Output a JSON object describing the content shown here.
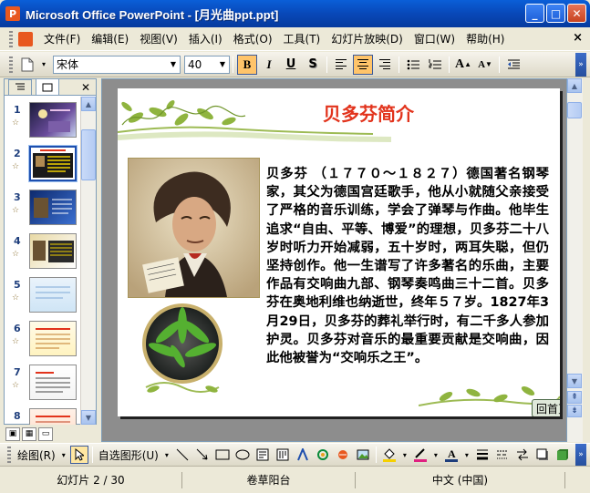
{
  "window": {
    "title": "Microsoft Office PowerPoint - [月光曲ppt.ppt]"
  },
  "menubar": {
    "items": [
      "文件(F)",
      "编辑(E)",
      "视图(V)",
      "插入(I)",
      "格式(O)",
      "工具(T)",
      "幻灯片放映(D)",
      "窗口(W)",
      "帮助(H)"
    ]
  },
  "format_toolbar": {
    "font_name": "宋体",
    "font_size": "40",
    "bold": "B",
    "italic": "I",
    "underline": "U",
    "shadow": "S",
    "grow": "A",
    "shrink": "A"
  },
  "thumbnails": {
    "numbers": [
      "1",
      "2",
      "3",
      "4",
      "5",
      "6",
      "7",
      "8"
    ],
    "selected_index": 2
  },
  "slide": {
    "title": "贝多芬简介",
    "body": "贝多芬 （１７７０～１８２７）德国著名钢琴家，其父为德国宫廷歌手，他从小就随父亲接受了严格的音乐训练，学会了弹琴与作曲。他毕生追求“自由、平等、博爱”的理想，贝多芬二十八岁时听力开始减弱，五十岁时，两耳失聪，但仍坚持创作。他一生谱写了许多著名的乐曲，主要作品有交响曲九部、钢琴奏鸣曲三十二首。贝多芬在奥地利维也纳逝世，终年５７岁。1827年3月29日，贝多芬的葬礼举行时，有二千多人参加护灵。贝多芬对音乐的最重要贡献是交响曲，因此他被誉为“交响乐之王”。",
    "back_button": "回首页"
  },
  "draw_toolbar": {
    "draw_label": "绘图(R)",
    "autoshapes_label": "自选图形(U)"
  },
  "status": {
    "slide_info": "幻灯片 2 / 30",
    "design": "卷草阳台",
    "language": "中文 (中国)"
  },
  "colors": {
    "title_red": "#E2331C",
    "titlebar_blue": "#0A5FD8",
    "accent_selected": "#FFC46A"
  }
}
